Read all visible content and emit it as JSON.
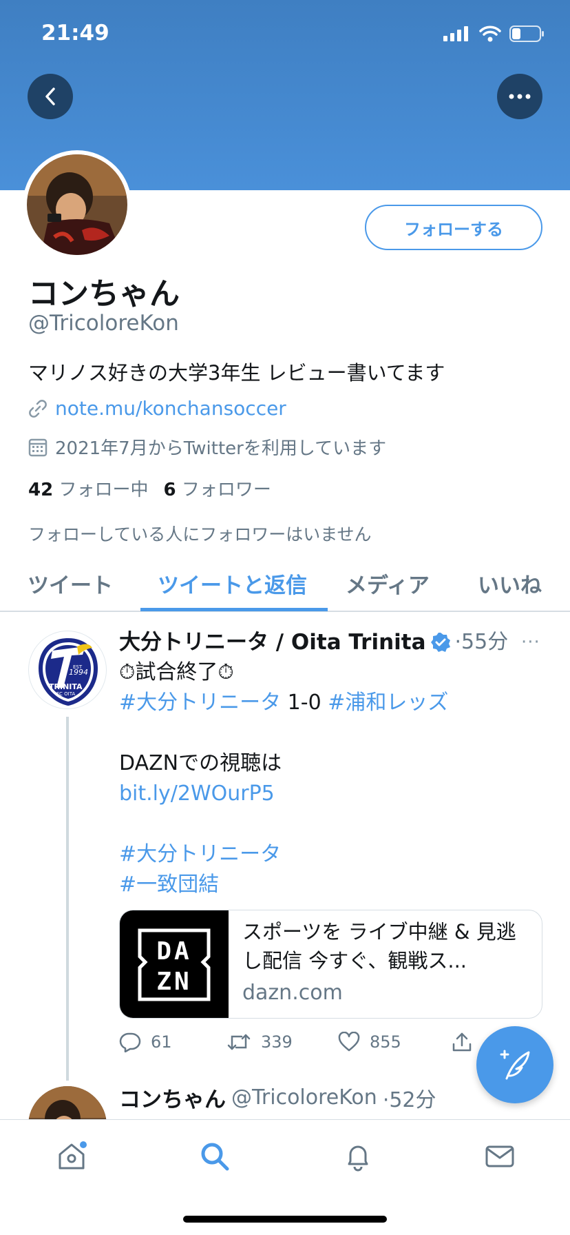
{
  "status_bar": {
    "time": "21:49"
  },
  "profile": {
    "display_name": "コンちゃん",
    "handle": "@TricoloreKon",
    "follow_label": "フォローする",
    "bio": "マリノス好きの大学3年生 レビュー書いてます",
    "link": "note.mu/konchansoccer",
    "joined": "2021年7月からTwitterを利用しています",
    "following_count": "42",
    "following_label": "フォロー中",
    "followers_count": "6",
    "followers_label": "フォロワー",
    "followers_note": "フォローしている人にフォロワーはいません"
  },
  "tabs": [
    {
      "label": "ツイート",
      "active": false
    },
    {
      "label": "ツイートと返信",
      "active": true
    },
    {
      "label": "メディア",
      "active": false
    },
    {
      "label": "いいね",
      "active": false
    }
  ],
  "tweet": {
    "author_name": "大分トリニータ / Oita Trinita",
    "time": "·55分",
    "more": "···",
    "lines": {
      "l1_emoji_left": "⏱",
      "l1_text": "試合終了",
      "l1_emoji_right": "⏱",
      "l2_tag1": "#大分トリニータ",
      "l2_score": " 1-0 ",
      "l2_tag2": "#浦和レッズ",
      "l3_text": "DAZNでの視聴は",
      "l4_link": "bit.ly/2WOurP5",
      "l5_tag": "#大分トリニータ",
      "l6_tag": "#一致団結"
    },
    "logo_text": {
      "est": "EST",
      "year": "1994",
      "name": "TRINITA",
      "sub": "FC OITA"
    },
    "card": {
      "logo_top": "DA",
      "logo_bottom": "ZN",
      "title": "スポーツを ライブ中継 & 見逃し配信 今すぐ、観戦ス...",
      "domain": "dazn.com"
    },
    "stats": {
      "replies": "61",
      "retweets": "339",
      "likes": "855"
    }
  },
  "tweet2": {
    "author_name": "コンちゃん",
    "handle": "@TricoloreKon",
    "time": "·52分"
  },
  "colors": {
    "accent": "#4a99e9",
    "banner": "#4a90d9",
    "muted": "#657786"
  },
  "icons": {
    "back": "chevron-left-icon",
    "more": "more-horizontal-icon",
    "link": "link-icon",
    "calendar": "calendar-icon",
    "verified": "verified-badge-icon",
    "reply": "reply-icon",
    "retweet": "retweet-icon",
    "like": "heart-icon",
    "share": "share-icon",
    "compose": "compose-feather-icon",
    "home": "home-icon",
    "search": "search-icon",
    "notifications": "bell-icon",
    "messages": "mail-icon"
  }
}
